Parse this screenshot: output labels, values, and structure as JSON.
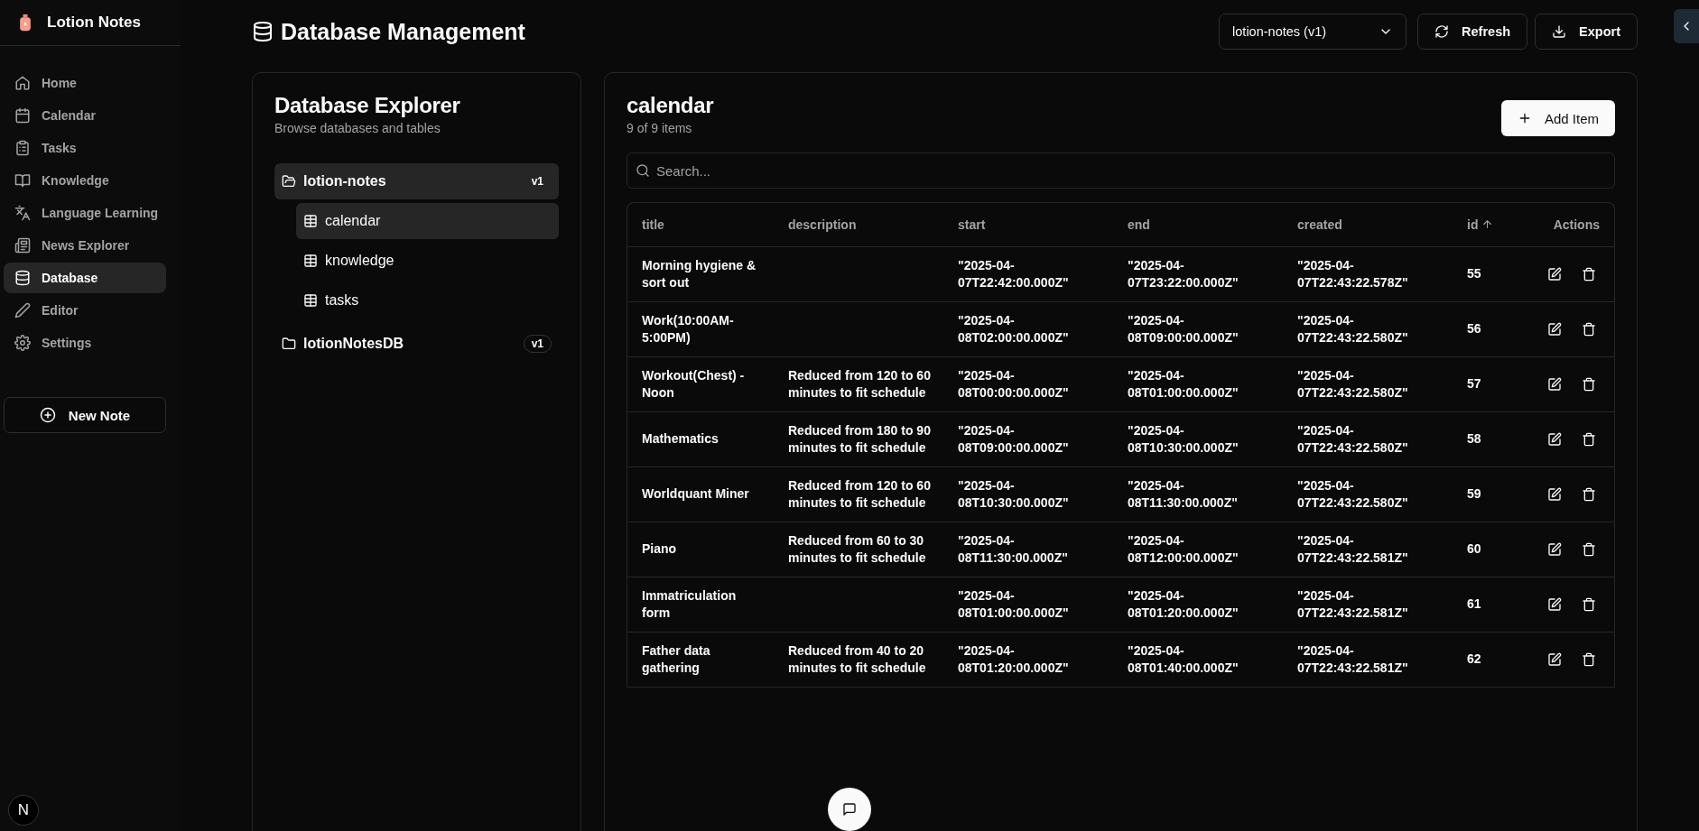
{
  "app": {
    "name": "Lotion Notes"
  },
  "sidebar": {
    "items": [
      {
        "label": "Home",
        "selected": false
      },
      {
        "label": "Calendar",
        "selected": false
      },
      {
        "label": "Tasks",
        "selected": false
      },
      {
        "label": "Knowledge",
        "selected": false
      },
      {
        "label": "Language Learning",
        "selected": false
      },
      {
        "label": "News Explorer",
        "selected": false
      },
      {
        "label": "Database",
        "selected": true
      },
      {
        "label": "Editor",
        "selected": false
      },
      {
        "label": "Settings",
        "selected": false
      }
    ],
    "new_note_button": "New Note",
    "avatar": "N"
  },
  "header": {
    "title": "Database Management",
    "database_select": "lotion-notes (v1)",
    "buttons": [
      "Refresh",
      "Export"
    ]
  },
  "explorer": {
    "title": "Database Explorer",
    "subtitle": "Browse databases and tables",
    "databases": [
      {
        "name": "lotion-notes",
        "version": "v1",
        "expanded": true,
        "selected": true,
        "children": [
          {
            "name": "calendar",
            "selected": true
          },
          {
            "name": "knowledge",
            "selected": false
          },
          {
            "name": "tasks",
            "selected": false
          }
        ]
      },
      {
        "name": "lotionNotesDB",
        "version": "v1",
        "expanded": false,
        "selected": false
      }
    ]
  },
  "table_view": {
    "title": "calendar",
    "count": "9 of 9 items",
    "add_button": "Add Item",
    "search": {
      "placeholder": "Search..."
    },
    "table": {
      "columns": [
        {
          "label": "title",
          "sorted": false
        },
        {
          "label": "description",
          "sorted": false
        },
        {
          "label": "start",
          "sorted": false
        },
        {
          "label": "end",
          "sorted": false
        },
        {
          "label": "created",
          "sorted": false
        },
        {
          "label": "id",
          "sorted": true
        },
        {
          "label": "Actions",
          "sorted": false
        }
      ],
      "rows": [
        {
          "title": "Morning hygiene & sort out",
          "start": "\"2025-04-07T22:42:00.000Z\"",
          "end": "\"2025-04-07T23:22:00.000Z\"",
          "created": "\"2025-04-07T22:43:22.578Z\"",
          "id": "55"
        },
        {
          "title": "Work(10:00AM-5:00PM)",
          "start": "\"2025-04-08T02:00:00.000Z\"",
          "end": "\"2025-04-08T09:00:00.000Z\"",
          "created": "\"2025-04-07T22:43:22.580Z\"",
          "id": "56"
        },
        {
          "title": "Workout(Chest) - Noon",
          "description": "Reduced from 120 to 60 minutes to fit schedule",
          "start": "\"2025-04-08T00:00:00.000Z\"",
          "end": "\"2025-04-08T01:00:00.000Z\"",
          "created": "\"2025-04-07T22:43:22.580Z\"",
          "id": "57"
        },
        {
          "title": "Mathematics",
          "description": "Reduced from 180 to 90 minutes to fit schedule",
          "start": "\"2025-04-08T09:00:00.000Z\"",
          "end": "\"2025-04-08T10:30:00.000Z\"",
          "created": "\"2025-04-07T22:43:22.580Z\"",
          "id": "58"
        },
        {
          "title": "Worldquant Miner",
          "description": "Reduced from 120 to 60 minutes to fit schedule",
          "start": "\"2025-04-08T10:30:00.000Z\"",
          "end": "\"2025-04-08T11:30:00.000Z\"",
          "created": "\"2025-04-07T22:43:22.580Z\"",
          "id": "59"
        },
        {
          "title": "Piano",
          "description": "Reduced from 60 to 30 minutes to fit schedule",
          "start": "\"2025-04-08T11:30:00.000Z\"",
          "end": "\"2025-04-08T12:00:00.000Z\"",
          "created": "\"2025-04-07T22:43:22.581Z\"",
          "id": "60"
        },
        {
          "title": "Immatriculation form",
          "start": "\"2025-04-08T01:00:00.000Z\"",
          "end": "\"2025-04-08T01:20:00.000Z\"",
          "created": "\"2025-04-07T22:43:22.581Z\"",
          "id": "61"
        },
        {
          "title": "Father data gathering",
          "description": "Reduced from 40 to 20 minutes to fit schedule",
          "start": "\"2025-04-08T01:20:00.000Z\"",
          "end": "\"2025-04-08T01:40:00.000Z\"",
          "created": "\"2025-04-07T22:43:22.581Z\"",
          "id": "62"
        }
      ]
    }
  }
}
